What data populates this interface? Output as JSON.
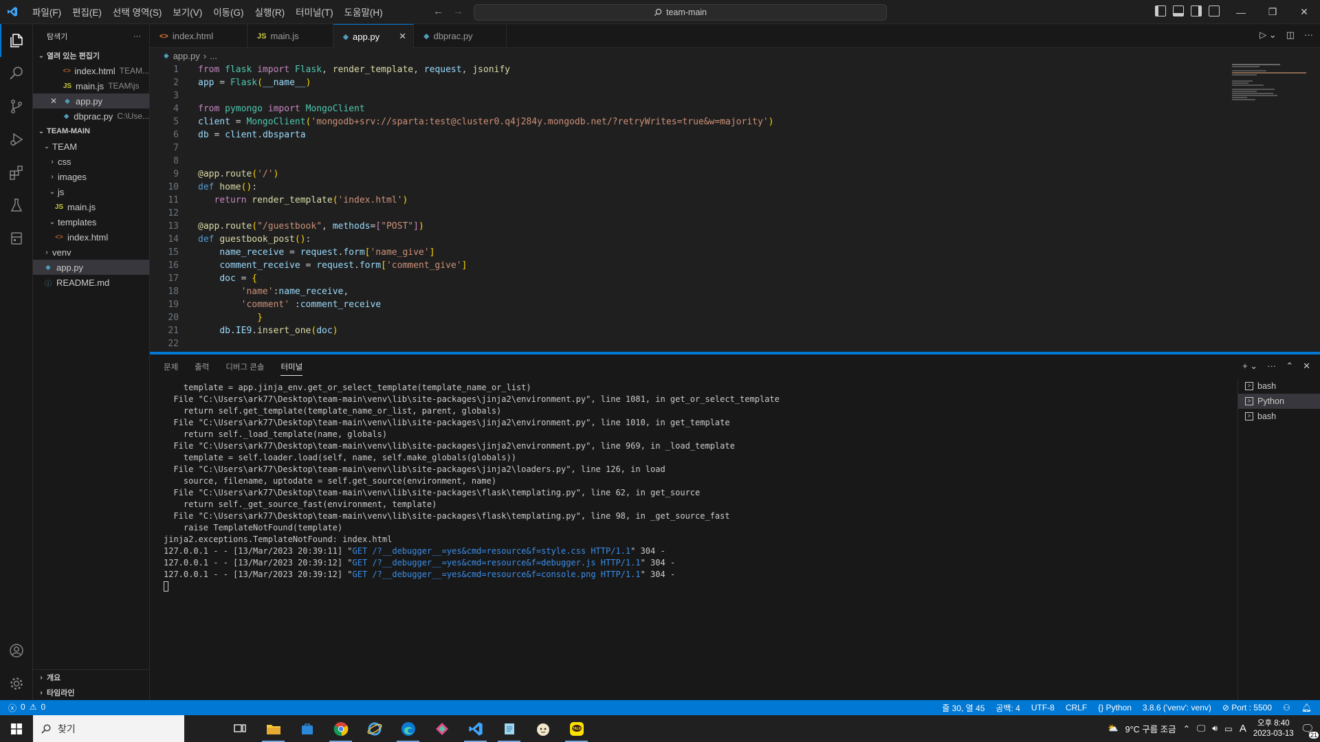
{
  "titlebar": {
    "menu": [
      "파일(F)",
      "편집(E)",
      "선택 영역(S)",
      "보기(V)",
      "이동(G)",
      "실행(R)",
      "터미널(T)",
      "도움말(H)"
    ],
    "command_center": "team-main"
  },
  "sidebar": {
    "title": "탐색기",
    "open_editors_label": "열려 있는 편집기",
    "open_editors": [
      {
        "name": "index.html",
        "desc": "TEAM...",
        "icon": "html-file-icon"
      },
      {
        "name": "main.js",
        "desc": "TEAM\\js",
        "icon": "js-file-icon"
      },
      {
        "name": "app.py",
        "desc": "",
        "icon": "python-file-icon"
      },
      {
        "name": "dbprac.py",
        "desc": "C:\\Use...",
        "icon": "python-file-icon"
      }
    ],
    "workspace_label": "TEAM-MAIN",
    "tree": {
      "team": "TEAM",
      "css": "css",
      "images": "images",
      "js": "js",
      "main_js": "main.js",
      "templates": "templates",
      "index_html": "index.html",
      "venv": "venv",
      "app_py": "app.py",
      "readme": "README.md"
    },
    "outline_label": "개요",
    "timeline_label": "타임라인"
  },
  "tabs": [
    {
      "name": "index.html",
      "active": false
    },
    {
      "name": "main.js",
      "active": false
    },
    {
      "name": "app.py",
      "active": true
    },
    {
      "name": "dbprac.py",
      "active": false
    }
  ],
  "breadcrumb": {
    "file": "app.py",
    "rest": "..."
  },
  "editor": {
    "line_numbers": [
      "1",
      "2",
      "3",
      "4",
      "5",
      "6",
      "7",
      "8",
      "9",
      "10",
      "11",
      "12",
      "13",
      "14",
      "15",
      "16",
      "17",
      "18",
      "19",
      "20",
      "21",
      "22"
    ],
    "mongo_uri": "'mongodb+srv://sparta:test@cluster0.q4j284y.mongodb.net/?retryWrites=true&w=majority'"
  },
  "panel": {
    "tabs": [
      "문제",
      "출력",
      "디버그 콘솔",
      "터미널"
    ],
    "active_tab": "터미널",
    "terminals": [
      "bash",
      "Python",
      "bash"
    ],
    "terminal_lines": [
      "    template = app.jinja_env.get_or_select_template(template_name_or_list)",
      "  File \"C:\\Users\\ark77\\Desktop\\team-main\\venv\\lib\\site-packages\\jinja2\\environment.py\", line 1081, in get_or_select_template",
      "    return self.get_template(template_name_or_list, parent, globals)",
      "  File \"C:\\Users\\ark77\\Desktop\\team-main\\venv\\lib\\site-packages\\jinja2\\environment.py\", line 1010, in get_template",
      "    return self._load_template(name, globals)",
      "  File \"C:\\Users\\ark77\\Desktop\\team-main\\venv\\lib\\site-packages\\jinja2\\environment.py\", line 969, in _load_template",
      "    template = self.loader.load(self, name, self.make_globals(globals))",
      "  File \"C:\\Users\\ark77\\Desktop\\team-main\\venv\\lib\\site-packages\\jinja2\\loaders.py\", line 126, in load",
      "    source, filename, uptodate = self.get_source(environment, name)",
      "  File \"C:\\Users\\ark77\\Desktop\\team-main\\venv\\lib\\site-packages\\flask\\templating.py\", line 62, in get_source",
      "    return self._get_source_fast(environment, template)",
      "  File \"C:\\Users\\ark77\\Desktop\\team-main\\venv\\lib\\site-packages\\flask\\templating.py\", line 98, in _get_source_fast",
      "    raise TemplateNotFound(template)",
      "jinja2.exceptions.TemplateNotFound: index.html"
    ],
    "log_lines": [
      {
        "prefix": "127.0.0.1 - - [13/Mar/2023 20:39:11] \"",
        "url": "GET /?__debugger__=yes&cmd=resource&f=style.css HTTP/1.1",
        "suffix": "\" 304 -"
      },
      {
        "prefix": "127.0.0.1 - - [13/Mar/2023 20:39:12] \"",
        "url": "GET /?__debugger__=yes&cmd=resource&f=debugger.js HTTP/1.1",
        "suffix": "\" 304 -"
      },
      {
        "prefix": "127.0.0.1 - - [13/Mar/2023 20:39:12] \"",
        "url": "GET /?__debugger__=yes&cmd=resource&f=console.png HTTP/1.1",
        "suffix": "\" 304 -"
      }
    ]
  },
  "statusbar": {
    "errors": "0",
    "warnings": "0",
    "position": "줄 30, 열 45",
    "spaces": "공백: 4",
    "encoding": "UTF-8",
    "eol": "CRLF",
    "language": "Python",
    "interpreter": "3.8.6 ('venv': venv)",
    "port": "Port : 5500"
  },
  "taskbar": {
    "search_placeholder": "찾기",
    "weather": "9°C  구름 조금",
    "ime": "A",
    "time": "오후 8:40",
    "date": "2023-03-13",
    "notifications": "21"
  },
  "colors": {
    "accent": "#0078d4",
    "statusbar": "#0078d4"
  }
}
